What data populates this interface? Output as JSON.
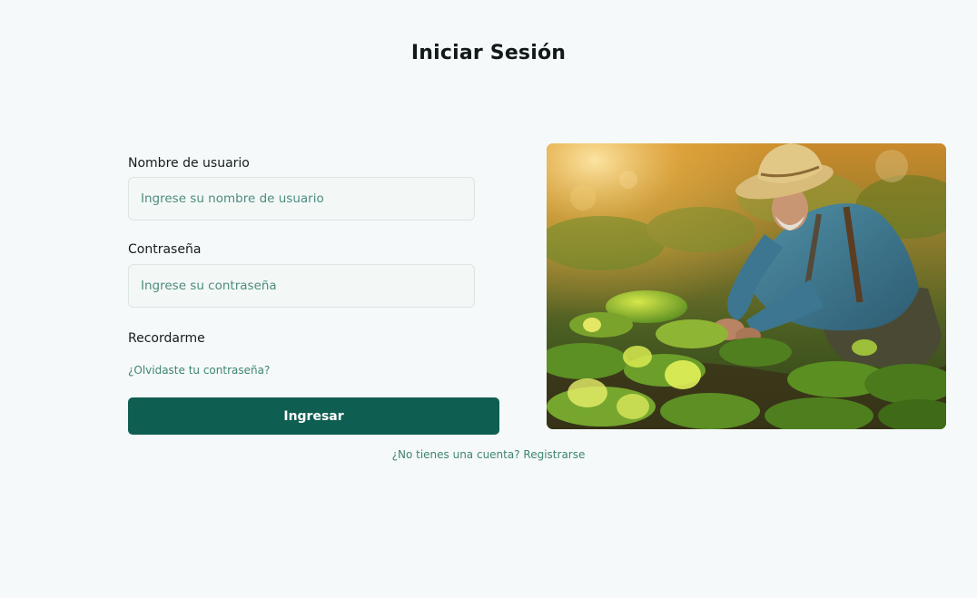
{
  "page": {
    "title": "Iniciar Sesión"
  },
  "login_form": {
    "username_label": "Nombre de usuario",
    "username_placeholder": "Ingrese su nombre de usuario",
    "username_value": "",
    "password_label": "Contraseña",
    "password_placeholder": "Ingrese su contraseña",
    "password_value": "",
    "remember_label": "Recordarme",
    "forgot_link": "¿Olvidaste tu contraseña?",
    "submit_label": "Ingresar"
  },
  "signup": {
    "prompt": "¿No tienes una cuenta?",
    "link": "Registrarse"
  },
  "colors": {
    "background": "#f5f9f9",
    "primary": "#0f5e52",
    "link": "#3f8473"
  }
}
